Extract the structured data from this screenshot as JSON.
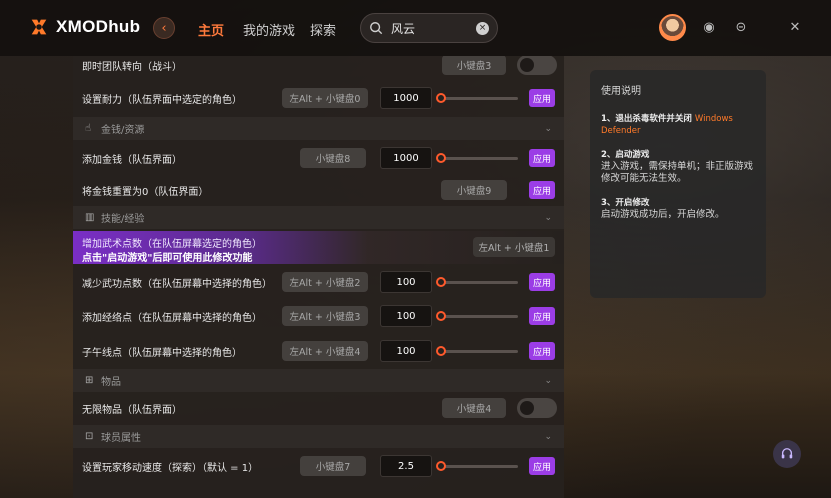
{
  "app": {
    "name": "XMODhub"
  },
  "nav": {
    "home": "主页",
    "games": "我的游戏",
    "explore": "探索"
  },
  "search": {
    "value": "风云"
  },
  "window": {
    "clear": "×"
  },
  "sections": {
    "money": "金钱/资源",
    "skills": "技能/经验",
    "items": "物品",
    "player": "球员属性"
  },
  "rows": [
    {
      "label": "即时团队转向（战斗）",
      "key": "小键盘3"
    },
    {
      "label": "设置耐力（队伍界面中选定的角色）",
      "key": "左Alt + 小键盘0",
      "value": "1000",
      "apply": "应用"
    },
    {
      "label": "添加金钱（队伍界面）",
      "key": "小键盘8",
      "value": "1000",
      "apply": "应用"
    },
    {
      "label": "将金钱重置为0（队伍界面）",
      "key": "小键盘9",
      "apply": "应用"
    },
    {
      "label": "增加武术点数（在队伍屏幕选定的角色）",
      "notice": "点击\"启动游戏\"后即可使用此修改功能",
      "key": "左Alt + 小键盘1"
    },
    {
      "label": "减少武功点数（在队伍屏幕中选择的角色）",
      "key": "左Alt + 小键盘2",
      "value": "100",
      "apply": "应用"
    },
    {
      "label": "添加经络点（在队伍屏幕中选择的角色）",
      "key": "左Alt + 小键盘3",
      "value": "100",
      "apply": "应用"
    },
    {
      "label": "子午线点（队伍屏幕中选择的角色）",
      "key": "左Alt + 小键盘4",
      "value": "100",
      "apply": "应用"
    },
    {
      "label": "无限物品（队伍界面）",
      "key": "小键盘4"
    },
    {
      "label": "设置玩家移动速度（探索）（默认 = 1）",
      "key": "小键盘7",
      "value": "2.5",
      "apply": "应用"
    }
  ],
  "help": {
    "title": "使用说明",
    "step1_title": "1、退出杀毒软件并关闭",
    "step1_accent": "Windows Defender",
    "step2_title": "2、启动游戏",
    "step2_desc": "进入游戏，需保持单机；非正版游戏修改可能无法生效。",
    "step3_title": "3、开启修改",
    "step3_desc": "启动游戏成功后，开启修改。"
  },
  "colors": {
    "accent": "#ff7a3c",
    "apply": "#9b3de6",
    "slider": "#ff5a2c"
  }
}
